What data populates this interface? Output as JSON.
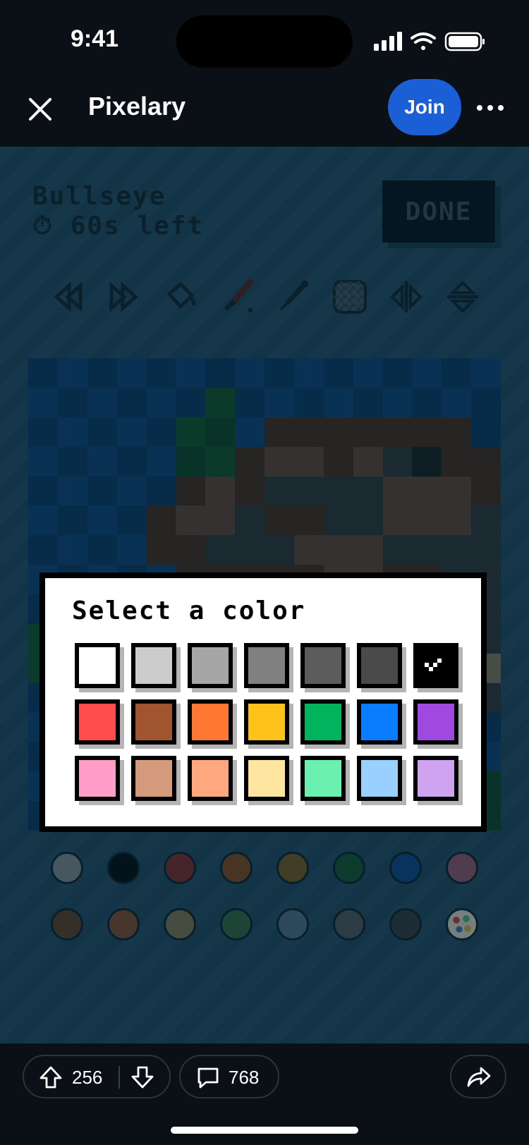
{
  "status": {
    "time": "9:41"
  },
  "header": {
    "title": "Pixelary",
    "join_label": "Join"
  },
  "game": {
    "title": "Bullseye",
    "timer": "⏱ 60s left",
    "done_label": "DONE"
  },
  "tools": [
    "undo-icon",
    "redo-icon",
    "fill-bucket-icon",
    "brush-icon",
    "eyedropper-icon",
    "eraser-icon",
    "mirror-horizontal-icon",
    "mirror-vertical-icon"
  ],
  "modal": {
    "title": "Select a color",
    "selected_index": 6
  },
  "swatches": [
    "#ffffff",
    "#cccccc",
    "#a6a6a6",
    "#808080",
    "#5c5c5c",
    "#4a4a4a",
    "#000000",
    "#ff4d4f",
    "#a0552e",
    "#ff7833",
    "#ffc21a",
    "#00b35c",
    "#0a7dff",
    "#a049e0",
    "#ff9ec8",
    "#d49a7c",
    "#ffa880",
    "#ffe6a0",
    "#6bf0b0",
    "#99d0ff",
    "#cfa3f0"
  ],
  "palette": [
    "#7a7f82",
    "#000000",
    "#7a1f1f",
    "#7a3f12",
    "#6e5014",
    "#0f4a24",
    "#063d7a",
    "#8a4d62",
    "#5a3520",
    "#7a4326",
    "#7a6a48",
    "#2d5e3a",
    "#4e6478",
    "#4a4d50",
    "#2e3133",
    "palette-icon"
  ],
  "footer": {
    "upvotes": "256",
    "comments": "768"
  },
  "colors": {
    "accent": "#1a5fd6",
    "background": "#1d4054"
  }
}
